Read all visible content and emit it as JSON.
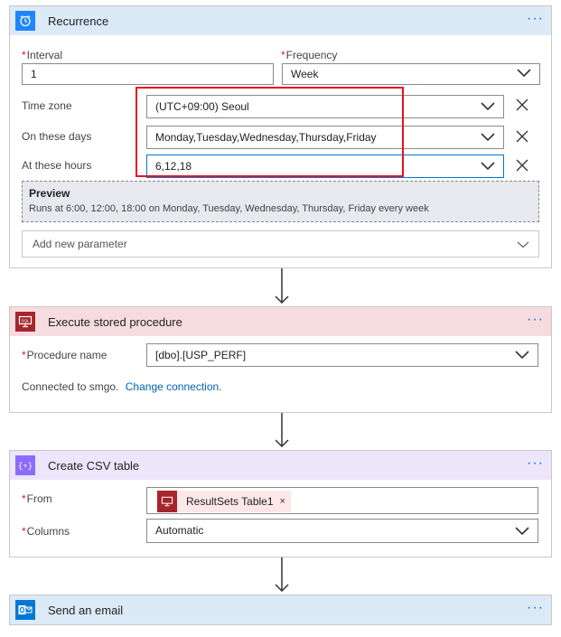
{
  "recurrence": {
    "title": "Recurrence",
    "more_icon": "more-dots-icon",
    "interval": {
      "label": "Interval",
      "value": "1"
    },
    "frequency": {
      "label": "Frequency",
      "value": "Week"
    },
    "time_zone": {
      "label": "Time zone",
      "value": "(UTC+09:00) Seoul"
    },
    "on_these_days": {
      "label": "On these days",
      "value": "Monday,Tuesday,Wednesday,Thursday,Friday"
    },
    "at_these_hours": {
      "label": "At these hours",
      "value": "6,12,18"
    },
    "preview": {
      "title": "Preview",
      "text": "Runs at 6:00, 12:00, 18:00 on Monday, Tuesday, Wednesday, Thursday, Friday every week"
    },
    "add_parameter": "Add new parameter",
    "header_color": "#dce9f7",
    "icon_color": "#1f85ff"
  },
  "stored_procedure": {
    "title": "Execute stored procedure",
    "procedure": {
      "label": "Procedure name",
      "value": "[dbo].[USP_PERF]"
    },
    "connected_text": "Connected to smgo.",
    "change_link": "Change connection.",
    "header_color": "#f7dcdf",
    "icon_color": "#a4262c"
  },
  "csv_table": {
    "title": "Create CSV table",
    "from": {
      "label": "From",
      "token": "ResultSets Table1",
      "token_remove": "×"
    },
    "columns": {
      "label": "Columns",
      "value": "Automatic"
    },
    "header_color": "#ece6fb",
    "icon_color": "#8c6cff"
  },
  "send_email": {
    "title": "Send an email",
    "header_color": "#dce9f7",
    "icon_color": "#0078d4"
  },
  "highlight_color": "#e81123",
  "more_label": "···"
}
